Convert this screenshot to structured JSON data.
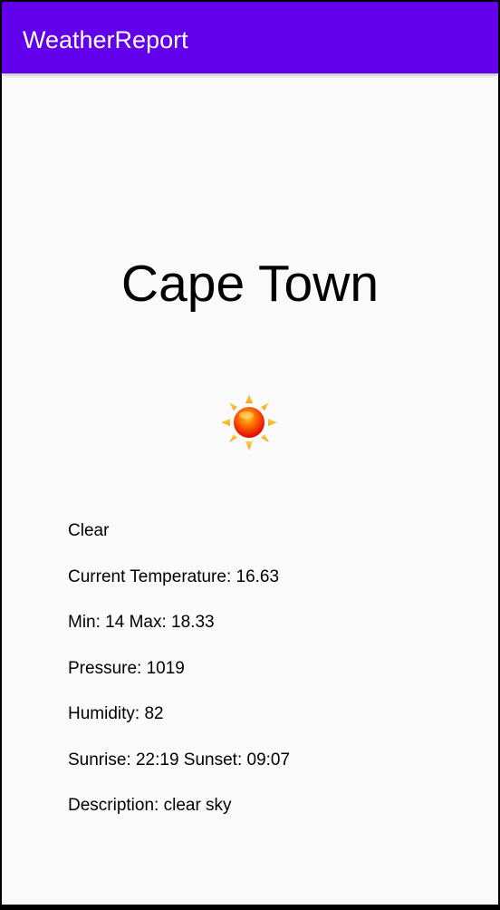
{
  "app": {
    "title": "WeatherReport",
    "accent_color": "#6200ee"
  },
  "weather": {
    "city": "Cape Town",
    "icon": "sun-icon",
    "condition": "Clear",
    "current_temperature": "Current Temperature: 16.63",
    "min_max": "Min: 14 Max: 18.33",
    "pressure": "Pressure: 1019",
    "humidity": "Humidity: 82",
    "sunrise_sunset": "Sunrise: 22:19 Sunset: 09:07",
    "description": "Description: clear sky"
  }
}
